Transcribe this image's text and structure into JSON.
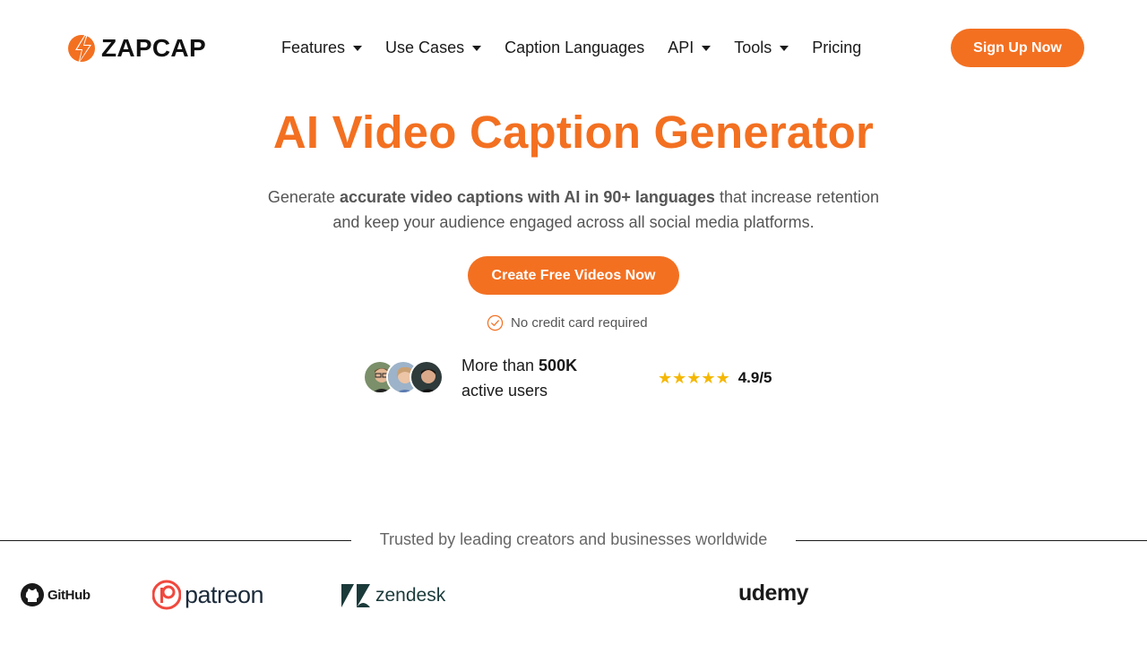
{
  "header": {
    "logo_text": "ZAPCAP",
    "logo_icon": "zapcap-bolt-icon",
    "nav": [
      {
        "label": "Features",
        "has_dropdown": true
      },
      {
        "label": "Use Cases",
        "has_dropdown": true
      },
      {
        "label": "Caption Languages",
        "has_dropdown": false
      },
      {
        "label": "API",
        "has_dropdown": true
      },
      {
        "label": "Tools",
        "has_dropdown": true
      },
      {
        "label": "Pricing",
        "has_dropdown": false
      }
    ],
    "signup_label": "Sign Up Now"
  },
  "hero": {
    "title": "AI Video Caption Generator",
    "subtitle_pre": "Generate ",
    "subtitle_bold": "accurate video captions with AI in 90+ languages",
    "subtitle_post": " that increase retention and keep your audience engaged across all social media platforms.",
    "cta_label": "Create Free Videos Now",
    "note": "No credit card required"
  },
  "social_proof": {
    "users_pre": "More than ",
    "users_bold": "500K",
    "users_post": "active users",
    "rating": "4.9/5",
    "stars": 5
  },
  "trusted": {
    "text": "Trusted by leading creators and businesses worldwide",
    "brands": [
      "GitHub",
      "patreon",
      "zendesk",
      "udemy"
    ]
  },
  "colors": {
    "accent": "#f37021",
    "star": "#f5b700",
    "text": "#1a1a1a",
    "muted": "#555555"
  }
}
